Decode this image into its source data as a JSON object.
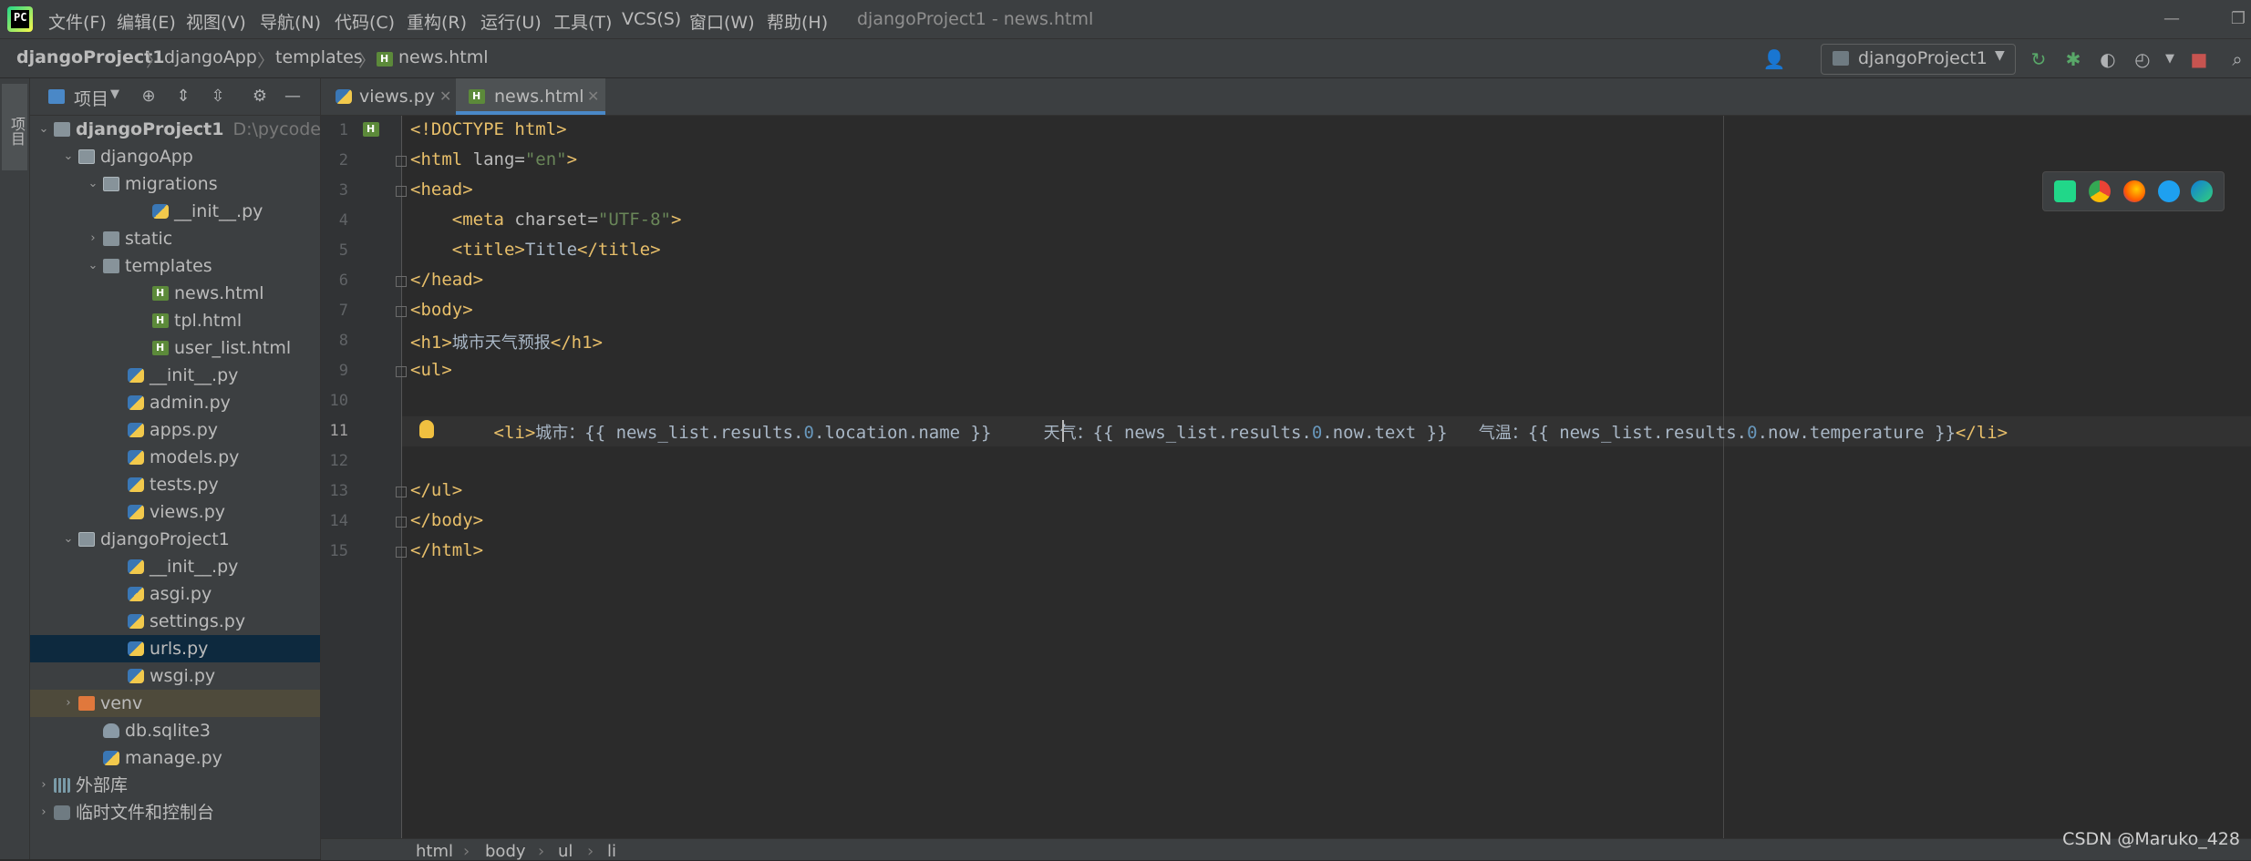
{
  "titlebar": {
    "menus": [
      "文件(F)",
      "编辑(E)",
      "视图(V)",
      "导航(N)",
      "代码(C)",
      "重构(R)",
      "运行(U)",
      "工具(T)",
      "VCS(S)",
      "窗口(W)",
      "帮助(H)"
    ],
    "window_title": "djangoProject1 - news.html"
  },
  "navbar": {
    "breadcrumbs": [
      "djangoProject1",
      "djangoApp",
      "templates",
      "news.html"
    ],
    "run_config": "djangoProject1"
  },
  "left_stripe": {
    "project_tab": "项目"
  },
  "project_panel": {
    "title": "项目",
    "tree": [
      {
        "label": "djangoProject1",
        "path": "D:\\pycode\\d",
        "indent": 0,
        "arrow": "down",
        "icon": "folder"
      },
      {
        "label": "djangoApp",
        "indent": 1,
        "arrow": "down",
        "icon": "folder-mod"
      },
      {
        "label": "migrations",
        "indent": 2,
        "arrow": "down",
        "icon": "folder-mod"
      },
      {
        "label": "__init__.py",
        "indent": 4,
        "arrow": "",
        "icon": "py"
      },
      {
        "label": "static",
        "indent": 2,
        "arrow": "right",
        "icon": "folder"
      },
      {
        "label": "templates",
        "indent": 2,
        "arrow": "down",
        "icon": "folder"
      },
      {
        "label": "news.html",
        "indent": 4,
        "arrow": "",
        "icon": "html"
      },
      {
        "label": "tpl.html",
        "indent": 4,
        "arrow": "",
        "icon": "html"
      },
      {
        "label": "user_list.html",
        "indent": 4,
        "arrow": "",
        "icon": "html"
      },
      {
        "label": "__init__.py",
        "indent": 3,
        "arrow": "",
        "icon": "py"
      },
      {
        "label": "admin.py",
        "indent": 3,
        "arrow": "",
        "icon": "py"
      },
      {
        "label": "apps.py",
        "indent": 3,
        "arrow": "",
        "icon": "py"
      },
      {
        "label": "models.py",
        "indent": 3,
        "arrow": "",
        "icon": "py"
      },
      {
        "label": "tests.py",
        "indent": 3,
        "arrow": "",
        "icon": "py"
      },
      {
        "label": "views.py",
        "indent": 3,
        "arrow": "",
        "icon": "py"
      },
      {
        "label": "djangoProject1",
        "indent": 1,
        "arrow": "down",
        "icon": "folder-mod"
      },
      {
        "label": "__init__.py",
        "indent": 3,
        "arrow": "",
        "icon": "py"
      },
      {
        "label": "asgi.py",
        "indent": 3,
        "arrow": "",
        "icon": "py"
      },
      {
        "label": "settings.py",
        "indent": 3,
        "arrow": "",
        "icon": "py"
      },
      {
        "label": "urls.py",
        "indent": 3,
        "arrow": "",
        "icon": "py",
        "selected": true
      },
      {
        "label": "wsgi.py",
        "indent": 3,
        "arrow": "",
        "icon": "py"
      },
      {
        "label": "venv",
        "indent": 1,
        "arrow": "right",
        "icon": "folder-venv",
        "highlight": true
      },
      {
        "label": "db.sqlite3",
        "indent": 2,
        "arrow": "",
        "icon": "db"
      },
      {
        "label": "manage.py",
        "indent": 2,
        "arrow": "",
        "icon": "py"
      },
      {
        "label": "外部库",
        "indent": 0,
        "arrow": "right",
        "icon": "lib"
      },
      {
        "label": "临时文件和控制台",
        "indent": 0,
        "arrow": "right",
        "icon": "scratch"
      }
    ]
  },
  "editor": {
    "tabs": [
      {
        "label": "views.py",
        "icon": "py",
        "active": false
      },
      {
        "label": "news.html",
        "icon": "html",
        "active": true
      }
    ],
    "current_line": 11,
    "line_numbers": [
      "1",
      "2",
      "3",
      "4",
      "5",
      "6",
      "7",
      "8",
      "9",
      "10",
      "11",
      "12",
      "13",
      "14",
      "15"
    ],
    "code": {
      "l1": "<!DOCTYPE html>",
      "l2_open": "<html ",
      "l2_attr": "lang=",
      "l2_val": "\"en\"",
      "l2_close": ">",
      "l3": "<head>",
      "l4_open": "    <meta ",
      "l4_attr": "charset=",
      "l4_val": "\"UTF-8\"",
      "l4_close": ">",
      "l5_open": "    <title>",
      "l5_text": "Title",
      "l5_close": "</title>",
      "l6": "</head>",
      "l7": "<body>",
      "l8_open": "<h1>",
      "l8_text": "城市天气预报",
      "l8_close": "</h1>",
      "l9": "<ul>",
      "l11_indent": "        ",
      "l11_li": "<li>",
      "l11_city": "城市：",
      "l11_expr1_a": "{{ news_list.results.",
      "l11_num1": "0",
      "l11_expr1_b": ".location.name }}",
      "l11_weather": "天气：",
      "l11_expr2_a": "{{ news_list.results.",
      "l11_num2": "0",
      "l11_expr2_b": ".now.text }}",
      "l11_temp": "气温：",
      "l11_expr3_a": "{{ news_list.results.",
      "l11_num3": "0",
      "l11_expr3_b": ".now.temperature }}",
      "l11_li_close": "</li>",
      "l13": "</ul>",
      "l14": "</body>",
      "l15": "</html>"
    }
  },
  "bottom_breadcrumb": [
    "html",
    "body",
    "ul",
    "li"
  ],
  "watermark": "CSDN @Maruko_428",
  "colors": {
    "tag": "#e8bf6a",
    "attr_value": "#6a8759",
    "number": "#6897bb",
    "selection": "#0d293e",
    "accent": "#4a88c7"
  }
}
